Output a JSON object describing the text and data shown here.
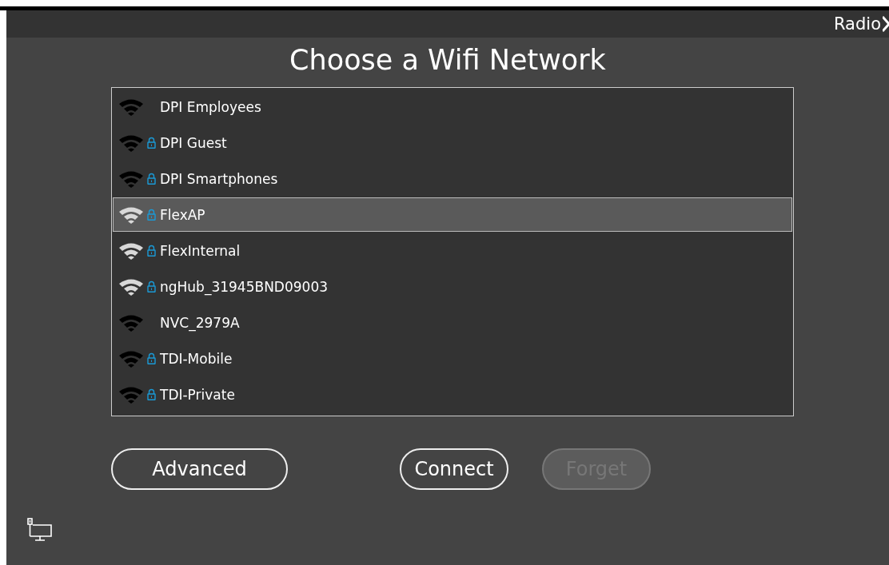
{
  "header": {
    "radio_label": "Radio"
  },
  "title": "Choose a Wifi Network",
  "networks": [
    {
      "name": "DPI Employees",
      "secured": false,
      "strong": false,
      "selected": false
    },
    {
      "name": "DPI Guest",
      "secured": true,
      "strong": false,
      "selected": false
    },
    {
      "name": "DPI Smartphones",
      "secured": true,
      "strong": false,
      "selected": false
    },
    {
      "name": "FlexAP",
      "secured": true,
      "strong": true,
      "selected": true
    },
    {
      "name": "FlexInternal",
      "secured": true,
      "strong": true,
      "selected": false
    },
    {
      "name": "ngHub_31945BND09003",
      "secured": true,
      "strong": true,
      "selected": false
    },
    {
      "name": "NVC_2979A",
      "secured": false,
      "strong": false,
      "selected": false
    },
    {
      "name": "TDI-Mobile",
      "secured": true,
      "strong": false,
      "selected": false
    },
    {
      "name": "TDI-Private",
      "secured": true,
      "strong": false,
      "selected": false
    }
  ],
  "buttons": [
    {
      "label": "Advanced",
      "disabled": false
    },
    {
      "label": "Connect",
      "disabled": false
    },
    {
      "label": "Forget",
      "disabled": true
    }
  ]
}
